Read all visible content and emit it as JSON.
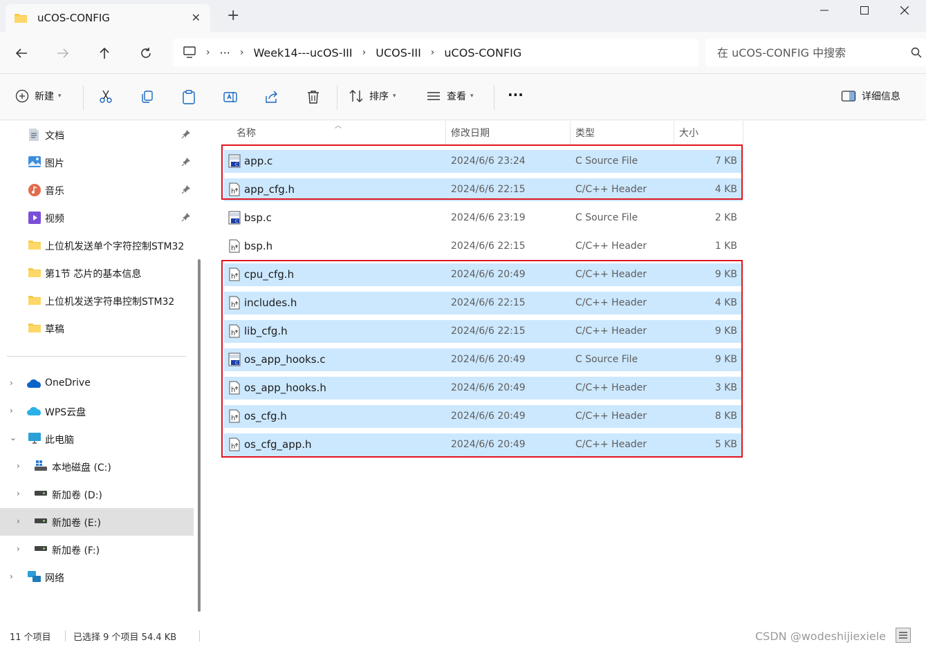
{
  "tab": {
    "title": "uCOS-CONFIG"
  },
  "breadcrumb": {
    "more": "···",
    "items": [
      "Week14---ucOS-III",
      "UCOS-III",
      "uCOS-CONFIG"
    ]
  },
  "search": {
    "placeholder": "在 uCOS-CONFIG 中搜索"
  },
  "toolbar": {
    "new_label": "新建",
    "sort_label": "排序",
    "view_label": "查看",
    "more_label": "···",
    "details_label": "详细信息"
  },
  "sidebar": {
    "quick": [
      {
        "label": "文档",
        "icon": "documents-icon",
        "pinned": true
      },
      {
        "label": "图片",
        "icon": "pictures-icon",
        "pinned": true
      },
      {
        "label": "音乐",
        "icon": "music-icon",
        "pinned": true
      },
      {
        "label": "视频",
        "icon": "videos-icon",
        "pinned": true
      },
      {
        "label": "上位机发送单个字符控制STM32",
        "icon": "folder-icon",
        "pinned": false
      },
      {
        "label": "第1节 芯片的基本信息",
        "icon": "folder-icon",
        "pinned": false
      },
      {
        "label": "上位机发送字符串控制STM32",
        "icon": "folder-icon",
        "pinned": false
      },
      {
        "label": "草稿",
        "icon": "folder-icon",
        "pinned": false
      }
    ],
    "tree": [
      {
        "label": "OneDrive",
        "icon": "onedrive-icon",
        "expanded": false
      },
      {
        "label": "WPS云盘",
        "icon": "wps-cloud-icon",
        "expanded": false
      },
      {
        "label": "此电脑",
        "icon": "this-pc-icon",
        "expanded": true
      },
      {
        "label": "本地磁盘 (C:)",
        "icon": "system-drive-icon",
        "expanded": false
      },
      {
        "label": "新加卷 (D:)",
        "icon": "drive-icon",
        "expanded": false
      },
      {
        "label": "新加卷 (E:)",
        "icon": "drive-icon",
        "expanded": false,
        "selected": true
      },
      {
        "label": "新加卷 (F:)",
        "icon": "drive-icon",
        "expanded": false
      },
      {
        "label": "网络",
        "icon": "network-icon",
        "expanded": false
      }
    ]
  },
  "columns": {
    "name": "名称",
    "modified": "修改日期",
    "type": "类型",
    "size": "大小"
  },
  "files": [
    {
      "name": "app.c",
      "date": "2024/6/6 23:24",
      "type": "C Source File",
      "size": "7 KB",
      "kind": "c",
      "selected": true
    },
    {
      "name": "app_cfg.h",
      "date": "2024/6/6 22:15",
      "type": "C/C++ Header",
      "size": "4 KB",
      "kind": "h",
      "selected": true
    },
    {
      "name": "bsp.c",
      "date": "2024/6/6 23:19",
      "type": "C Source File",
      "size": "2 KB",
      "kind": "c",
      "selected": false
    },
    {
      "name": "bsp.h",
      "date": "2024/6/6 22:15",
      "type": "C/C++ Header",
      "size": "1 KB",
      "kind": "h",
      "selected": false
    },
    {
      "name": "cpu_cfg.h",
      "date": "2024/6/6 20:49",
      "type": "C/C++ Header",
      "size": "9 KB",
      "kind": "h",
      "selected": true
    },
    {
      "name": "includes.h",
      "date": "2024/6/6 22:15",
      "type": "C/C++ Header",
      "size": "4 KB",
      "kind": "h",
      "selected": true
    },
    {
      "name": "lib_cfg.h",
      "date": "2024/6/6 22:15",
      "type": "C/C++ Header",
      "size": "9 KB",
      "kind": "h",
      "selected": true
    },
    {
      "name": "os_app_hooks.c",
      "date": "2024/6/6 20:49",
      "type": "C Source File",
      "size": "9 KB",
      "kind": "c",
      "selected": true
    },
    {
      "name": "os_app_hooks.h",
      "date": "2024/6/6 20:49",
      "type": "C/C++ Header",
      "size": "3 KB",
      "kind": "h",
      "selected": true
    },
    {
      "name": "os_cfg.h",
      "date": "2024/6/6 20:49",
      "type": "C/C++ Header",
      "size": "8 KB",
      "kind": "h",
      "selected": true
    },
    {
      "name": "os_cfg_app.h",
      "date": "2024/6/6 20:49",
      "type": "C/C++ Header",
      "size": "5 KB",
      "kind": "h",
      "selected": true
    }
  ],
  "status": {
    "count": "11 个项目",
    "selection": "已选择 9 个项目  54.4 KB"
  },
  "watermark": "CSDN @wodeshijiexiele",
  "colors": {
    "selection": "#cce8ff",
    "highlight_box": "#e0141e",
    "folder": "#f8c846"
  }
}
